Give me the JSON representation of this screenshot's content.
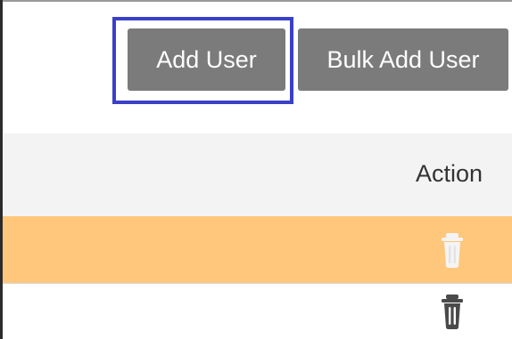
{
  "toolbar": {
    "add_user_label": "Add User",
    "bulk_add_user_label": "Bulk Add User"
  },
  "table": {
    "columns": [
      "Action"
    ],
    "rows": [
      {
        "state": "highlighted",
        "action_icon": "trash-icon"
      },
      {
        "state": "normal",
        "action_icon": "trash-icon"
      }
    ]
  },
  "colors": {
    "button_bg": "#7b7b7b",
    "button_text": "#ffffff",
    "focus_outline": "#3a40c7",
    "header_bg": "#f3f3f3",
    "highlight_row_bg": "#ffc77b",
    "trash_icon_light": "#f4f4f4",
    "trash_icon_dark": "#4a4a4a"
  }
}
